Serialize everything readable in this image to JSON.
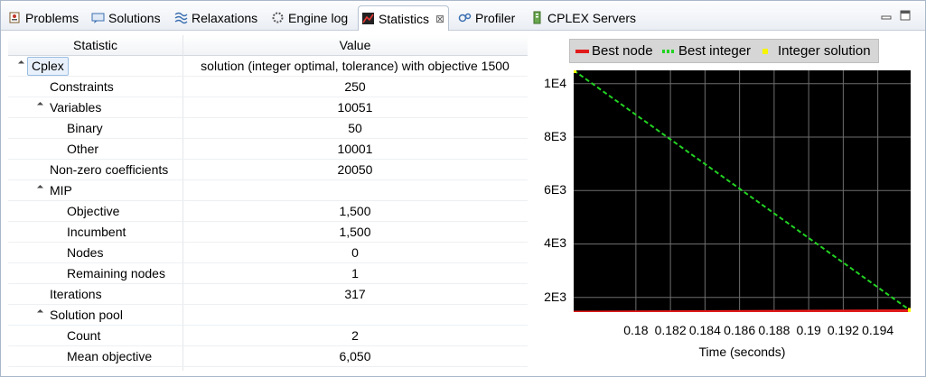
{
  "tabs": [
    {
      "label": "Problems",
      "icon": "problems-icon"
    },
    {
      "label": "Solutions",
      "icon": "solutions-icon"
    },
    {
      "label": "Relaxations",
      "icon": "relaxations-icon"
    },
    {
      "label": "Engine log",
      "icon": "engine-log-icon"
    },
    {
      "label": "Statistics",
      "icon": "statistics-icon",
      "close": "⊠"
    },
    {
      "label": "Profiler",
      "icon": "profiler-icon"
    },
    {
      "label": "CPLEX Servers",
      "icon": "cplex-servers-icon"
    }
  ],
  "table": {
    "headers": {
      "statistic": "Statistic",
      "value": "Value"
    },
    "rows": [
      {
        "label": "Cplex",
        "value": "solution (integer optimal, tolerance) with objective 1500"
      },
      {
        "label": "Constraints",
        "value": "250"
      },
      {
        "label": "Variables",
        "value": "10051"
      },
      {
        "label": "Binary",
        "value": "50"
      },
      {
        "label": "Other",
        "value": "10001"
      },
      {
        "label": "Non-zero coefficients",
        "value": "20050"
      },
      {
        "label": "MIP",
        "value": ""
      },
      {
        "label": "Objective",
        "value": "1,500"
      },
      {
        "label": "Incumbent",
        "value": "1,500"
      },
      {
        "label": "Nodes",
        "value": "0"
      },
      {
        "label": "Remaining nodes",
        "value": "1"
      },
      {
        "label": "Iterations",
        "value": "317"
      },
      {
        "label": "Solution pool",
        "value": ""
      },
      {
        "label": "Count",
        "value": "2"
      },
      {
        "label": "Mean objective",
        "value": "6,050"
      }
    ]
  },
  "chart_data": {
    "type": "line",
    "xlabel": "Time (seconds)",
    "ylabel": "",
    "x_ticks": [
      "0.18",
      "0.182",
      "0.184",
      "0.186",
      "0.188",
      "0.19",
      "0.192",
      "0.194"
    ],
    "y_ticks": [
      "2E3",
      "4E3",
      "6E3",
      "8E3",
      "1E4"
    ],
    "xlim": [
      0.1764,
      0.1959
    ],
    "ylim": [
      1450,
      10500
    ],
    "grid": true,
    "background": "#000000",
    "legend_position": "top",
    "series": [
      {
        "name": "Best node",
        "style": "solid",
        "color": "#e11b1b",
        "x": [
          0.1764,
          0.1959
        ],
        "y": [
          1450,
          1500
        ]
      },
      {
        "name": "Best integer",
        "style": "dashed",
        "color": "#22d322",
        "x": [
          0.1764,
          0.1959
        ],
        "y": [
          10500,
          1500
        ]
      },
      {
        "name": "Integer solution",
        "style": "points",
        "color": "#f5f500",
        "x": [
          0.1764,
          0.1959
        ],
        "y": [
          10500,
          1500
        ]
      }
    ]
  }
}
